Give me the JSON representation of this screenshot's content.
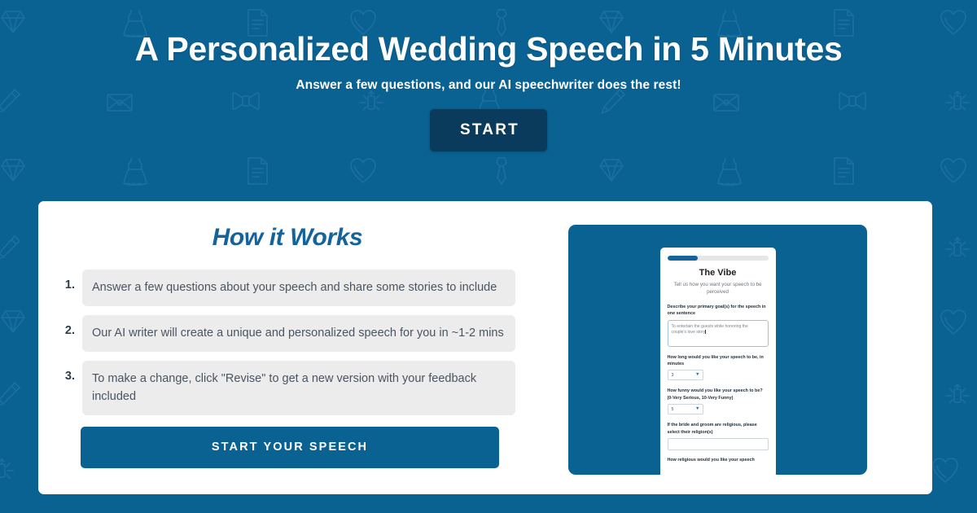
{
  "hero": {
    "title": "A Personalized Wedding Speech in 5 Minutes",
    "subtitle": "Answer a few questions, and our AI speechwriter does the rest!",
    "start_label": "START"
  },
  "card": {
    "how_it_works_title": "How it Works",
    "steps": [
      {
        "number": "1.",
        "text": "Answer a few questions about your speech and share some stories to include"
      },
      {
        "number": "2.",
        "text": "Our AI writer will create a unique and personalized speech for you in ~1-2 mins"
      },
      {
        "number": "3.",
        "text": "To make a change, click \"Revise\" to get a new version with your feedback included"
      }
    ],
    "cta_label": "START YOUR SPEECH"
  },
  "preview": {
    "progress_percent": 30,
    "title": "The Vibe",
    "subtitle": "Tell us how you want your speech to be perceived",
    "fields": [
      {
        "label": "Describe your primary goal(s) for the speech in one sentence",
        "type": "textarea",
        "value": "To entertain the guests while honoring the couple's love story"
      },
      {
        "label": "How long would you like your speech to be, in minutes",
        "type": "select",
        "value": "3"
      },
      {
        "label": "How funny would you like your speech to be? (0-Very Serious, 10-Very Funny)",
        "type": "select",
        "value": "5"
      },
      {
        "label": "If the bride and groom are religious, please select their religion(s)",
        "type": "text",
        "value": ""
      },
      {
        "label": "How religious would you like your speech",
        "type": "label-only",
        "value": ""
      }
    ]
  },
  "colors": {
    "brand_blue": "#0a6293",
    "dark_navy": "#0a3a5c",
    "accent_blue": "#14639b",
    "card_white": "#ffffff",
    "step_gray": "#ececec",
    "pattern_stroke": "#1a6fa0"
  },
  "pattern_icons": [
    "diamond-icon",
    "dress-icon",
    "document-icon",
    "heart-icon",
    "necktie-icon",
    "pen-icon",
    "envelope-icon",
    "bowtie-icon",
    "ring-sparkle-icon"
  ]
}
